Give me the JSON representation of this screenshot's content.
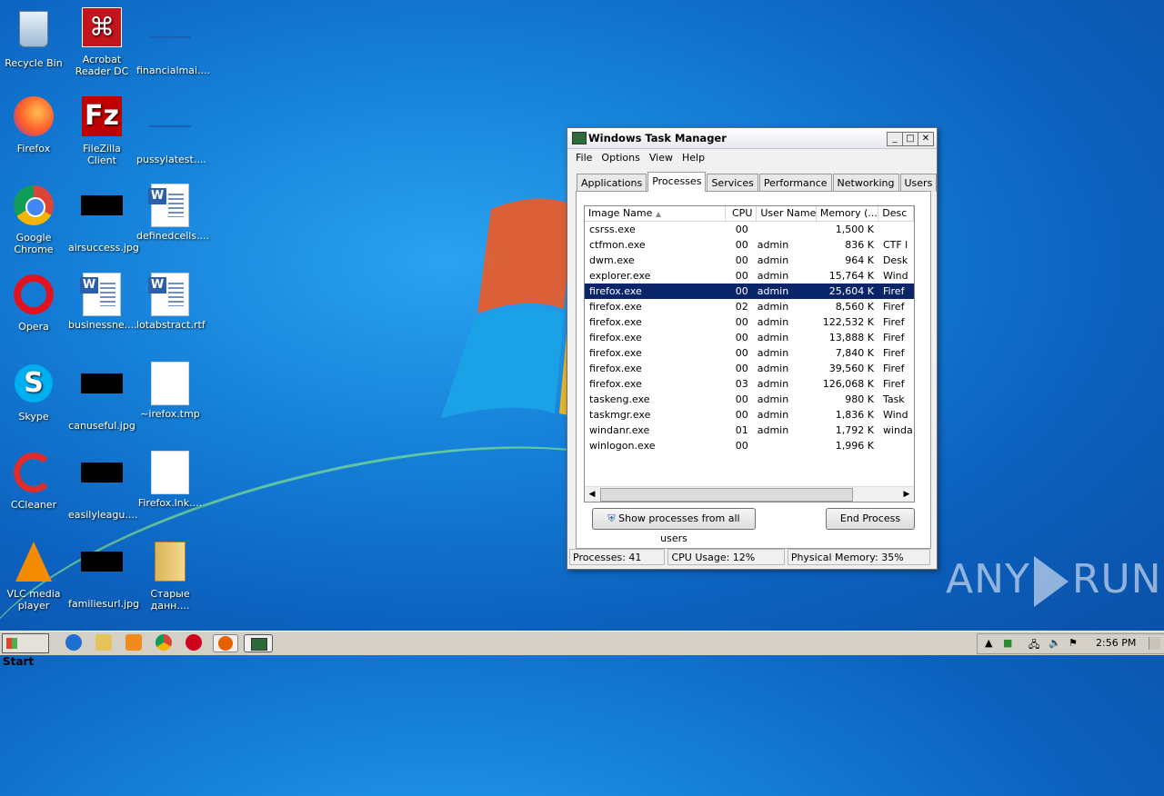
{
  "desktop": {
    "icons": [
      {
        "label": "Recycle Bin",
        "icon": "recycle-bin-icon"
      },
      {
        "label": "Acrobat Reader DC",
        "icon": "acrobat-icon"
      },
      {
        "label": "financialmai....",
        "icon": "file-icon"
      },
      {
        "label": "Firefox",
        "icon": "firefox-icon"
      },
      {
        "label": "FileZilla Client",
        "icon": "filezilla-icon"
      },
      {
        "label": "pussylatest....",
        "icon": "file-icon"
      },
      {
        "label": "Google Chrome",
        "icon": "chrome-icon"
      },
      {
        "label": "airsuccess.jpg",
        "icon": "image-icon"
      },
      {
        "label": "definedcells....",
        "icon": "word-icon"
      },
      {
        "label": "Opera",
        "icon": "opera-icon"
      },
      {
        "label": "businessne....",
        "icon": "word-icon"
      },
      {
        "label": "lotabstract.rtf",
        "icon": "word-icon"
      },
      {
        "label": "Skype",
        "icon": "skype-icon"
      },
      {
        "label": "canuseful.jpg",
        "icon": "image-icon"
      },
      {
        "label": "~irefox.tmp",
        "icon": "blank-file-icon"
      },
      {
        "label": "CCleaner",
        "icon": "ccleaner-icon"
      },
      {
        "label": "easilyleagu....",
        "icon": "image-icon"
      },
      {
        "label": "Firefox.lnk....",
        "icon": "blank-file-icon"
      },
      {
        "label": "VLC media player",
        "icon": "vlc-icon"
      },
      {
        "label": "familiesurl.jpg",
        "icon": "image-icon"
      },
      {
        "label": "Старые данн....",
        "icon": "folder-icon"
      }
    ]
  },
  "taskmgr": {
    "title": "Windows Task Manager",
    "menu": [
      "File",
      "Options",
      "View",
      "Help"
    ],
    "tabs": [
      "Applications",
      "Processes",
      "Services",
      "Performance",
      "Networking",
      "Users"
    ],
    "active_tab": "Processes",
    "columns": [
      "Image Name",
      "CPU",
      "User Name",
      "Memory (...",
      "Desc"
    ],
    "rows": [
      {
        "name": "csrss.exe",
        "cpu": "00",
        "user": "",
        "mem": "1,500 K",
        "desc": ""
      },
      {
        "name": "ctfmon.exe",
        "cpu": "00",
        "user": "admin",
        "mem": "836 K",
        "desc": "CTF l"
      },
      {
        "name": "dwm.exe",
        "cpu": "00",
        "user": "admin",
        "mem": "964 K",
        "desc": "Desk"
      },
      {
        "name": "explorer.exe",
        "cpu": "00",
        "user": "admin",
        "mem": "15,764 K",
        "desc": "Wind"
      },
      {
        "name": "firefox.exe",
        "cpu": "00",
        "user": "admin",
        "mem": "25,604 K",
        "desc": "Firef"
      },
      {
        "name": "firefox.exe",
        "cpu": "02",
        "user": "admin",
        "mem": "8,560 K",
        "desc": "Firef"
      },
      {
        "name": "firefox.exe",
        "cpu": "00",
        "user": "admin",
        "mem": "122,532 K",
        "desc": "Firef"
      },
      {
        "name": "firefox.exe",
        "cpu": "00",
        "user": "admin",
        "mem": "13,888 K",
        "desc": "Firef"
      },
      {
        "name": "firefox.exe",
        "cpu": "00",
        "user": "admin",
        "mem": "7,840 K",
        "desc": "Firef"
      },
      {
        "name": "firefox.exe",
        "cpu": "00",
        "user": "admin",
        "mem": "39,560 K",
        "desc": "Firef"
      },
      {
        "name": "firefox.exe",
        "cpu": "03",
        "user": "admin",
        "mem": "126,068 K",
        "desc": "Firef"
      },
      {
        "name": "taskeng.exe",
        "cpu": "00",
        "user": "admin",
        "mem": "980 K",
        "desc": "Task"
      },
      {
        "name": "taskmgr.exe",
        "cpu": "00",
        "user": "admin",
        "mem": "1,836 K",
        "desc": "Wind"
      },
      {
        "name": "windanr.exe",
        "cpu": "01",
        "user": "admin",
        "mem": "1,792 K",
        "desc": "winda"
      },
      {
        "name": "winlogon.exe",
        "cpu": "00",
        "user": "",
        "mem": "1,996 K",
        "desc": ""
      }
    ],
    "selected_row": 4,
    "show_all_label": "Show processes from all users",
    "end_process_label": "End Process",
    "status": {
      "processes": "Processes: 41",
      "cpu": "CPU Usage: 12%",
      "memory": "Physical Memory: 35%"
    }
  },
  "taskbar": {
    "start_label": "Start",
    "apps": [
      "ie-icon",
      "explorer-icon",
      "media-player-icon",
      "chrome-icon",
      "opera-icon",
      "firefox-icon",
      "taskmgr-icon"
    ],
    "clock": "2:56 PM"
  },
  "watermark": {
    "left": "ANY",
    "right": "RUN"
  }
}
